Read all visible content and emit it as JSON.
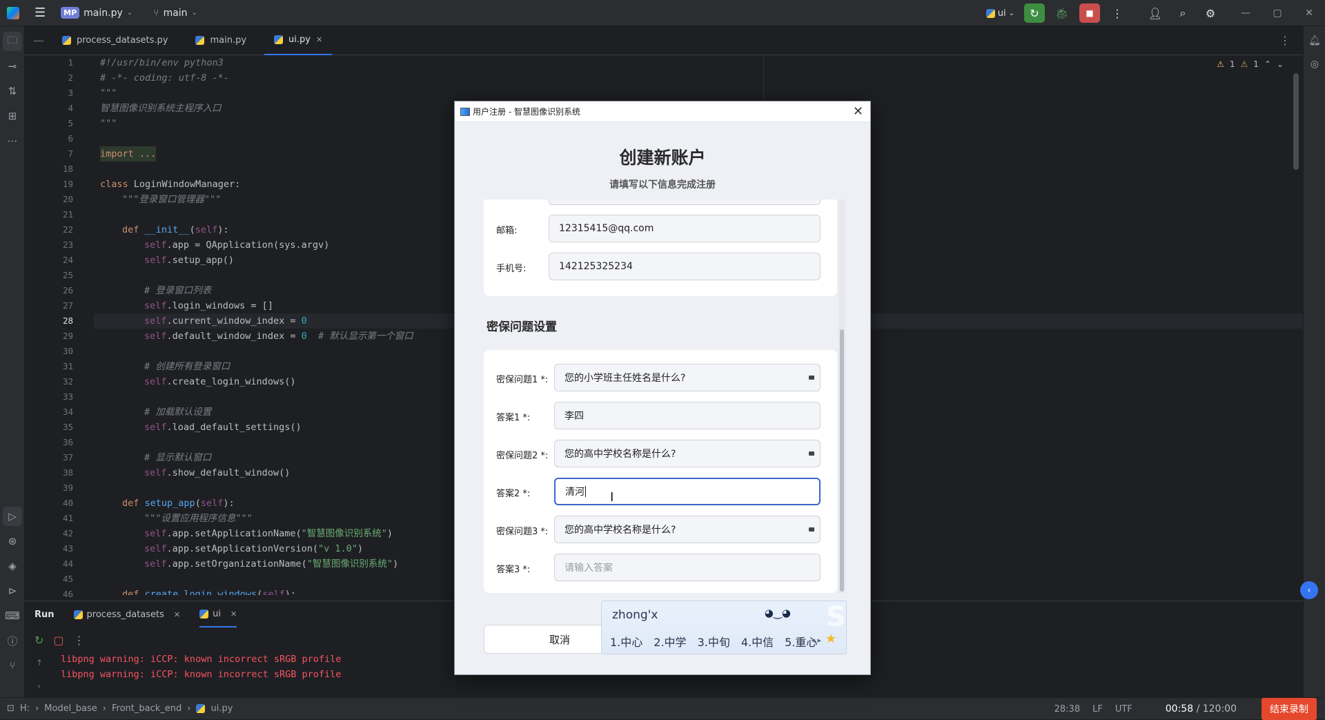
{
  "titlebar": {
    "project_badge": "MP",
    "project_name": "main.py",
    "branch": "main",
    "run_config": "ui"
  },
  "editor": {
    "tabs": [
      {
        "label": "process_datasets.py"
      },
      {
        "label": "main.py"
      },
      {
        "label": "ui.py"
      }
    ],
    "inspections": {
      "warnings": "1",
      "weak_warnings": "1"
    },
    "line_numbers": [
      "1",
      "2",
      "3",
      "4",
      "5",
      "6",
      "7",
      "18",
      "19",
      "20",
      "21",
      "22",
      "23",
      "24",
      "25",
      "26",
      "27",
      "28",
      "29",
      "30",
      "31",
      "32",
      "33",
      "34",
      "35",
      "36",
      "37",
      "38",
      "39",
      "40",
      "41",
      "42",
      "43",
      "44",
      "45",
      "46"
    ],
    "code": {
      "l1": "#!/usr/bin/env python3",
      "l2": "# -*- coding: utf-8 -*-",
      "l3": "\"\"\"",
      "l4": "智慧图像识别系统主程序入口",
      "l5": "\"\"\"",
      "l7": "import ...",
      "l19_kw": "class",
      "l19_name": "LoginWindowManager:",
      "l20": "\"\"\"登录窗口管理器\"\"\"",
      "l22_kw": "def",
      "l22_fn": "__init__",
      "l22_self": "self",
      "l23_self": "self",
      "l23_rest": ".app = QApplication(sys.argv)",
      "l24_self": "self",
      "l24_rest": ".setup_app()",
      "l26": "# 登录窗口列表",
      "l27_self": "self",
      "l27_rest": ".login_windows = []",
      "l28_self": "self",
      "l28_rest": ".current_window_index = ",
      "l28_num": "0",
      "l29_self": "self",
      "l29_rest": ".default_window_index = ",
      "l29_num": "0",
      "l29_cm": "# 默认显示第一个窗口",
      "l31": "# 创建所有登录窗口",
      "l32_self": "self",
      "l32_rest": ".create_login_windows()",
      "l34": "# 加载默认设置",
      "l35_self": "self",
      "l35_rest": ".load_default_settings()",
      "l37": "# 显示默认窗口",
      "l38_self": "self",
      "l38_rest": ".show_default_window()",
      "l40_kw": "def",
      "l40_fn": "setup_app",
      "l40_self": "self",
      "l41": "\"\"\"设置应用程序信息\"\"\"",
      "l42_self": "self",
      "l42_rest": ".app.setApplicationName(",
      "l42_str": "\"智慧图像识别系统\"",
      "l43_self": "self",
      "l43_rest": ".app.setApplicationVersion(",
      "l43_str": "\"v 1.0\"",
      "l44_self": "self",
      "l44_rest": ".app.setOrganizationName(",
      "l44_str": "\"智慧图像识别系统\"",
      "l46_kw": "def",
      "l46_fn": "create_login_windows",
      "l46_self": "self"
    }
  },
  "run_panel": {
    "title": "Run",
    "tabs": [
      {
        "label": "process_datasets"
      },
      {
        "label": "ui"
      }
    ],
    "output": [
      "libpng warning: iCCP: known incorrect sRGB profile",
      "libpng warning: iCCP: known incorrect sRGB profile"
    ]
  },
  "statusbar": {
    "breadcrumb": [
      "H:",
      "Model_base",
      "Front_back_end",
      "ui.py"
    ],
    "position": "28:38",
    "line_sep": "LF",
    "encoding": "UTF",
    "timer_elapsed": "00:58",
    "timer_total": "/ 120:00",
    "stop_recording": "结束录制"
  },
  "dialog": {
    "window_title": "用户注册 - 智慧图像识别系统",
    "heading": "创建新账户",
    "subheading": "请填写以下信息完成注册",
    "email_label": "邮箱:",
    "email_value": "12315415@qq.com",
    "phone_label": "手机号:",
    "phone_value": "142125325234",
    "security_section_title": "密保问题设置",
    "q1_label": "密保问题1 *:",
    "q1_value": "您的小学班主任姓名是什么?",
    "a1_label": "答案1 *:",
    "a1_value": "李四",
    "q2_label": "密保问题2 *:",
    "q2_value": "您的高中学校名称是什么?",
    "a2_label": "答案2 *:",
    "a2_value": "清河",
    "q3_label": "密保问题3 *:",
    "q3_value": "您的高中学校名称是什么?",
    "a3_label": "答案3 *:",
    "a3_placeholder": "请输入答案",
    "cancel_label": "取消"
  },
  "ime": {
    "composition": "zhong'x",
    "candidates": [
      "1.中心",
      "2.中学",
      "3.中旬",
      "4.中信",
      "5.重心"
    ]
  },
  "colors": {
    "accent": "#3574f0",
    "record": "#e5482d"
  }
}
